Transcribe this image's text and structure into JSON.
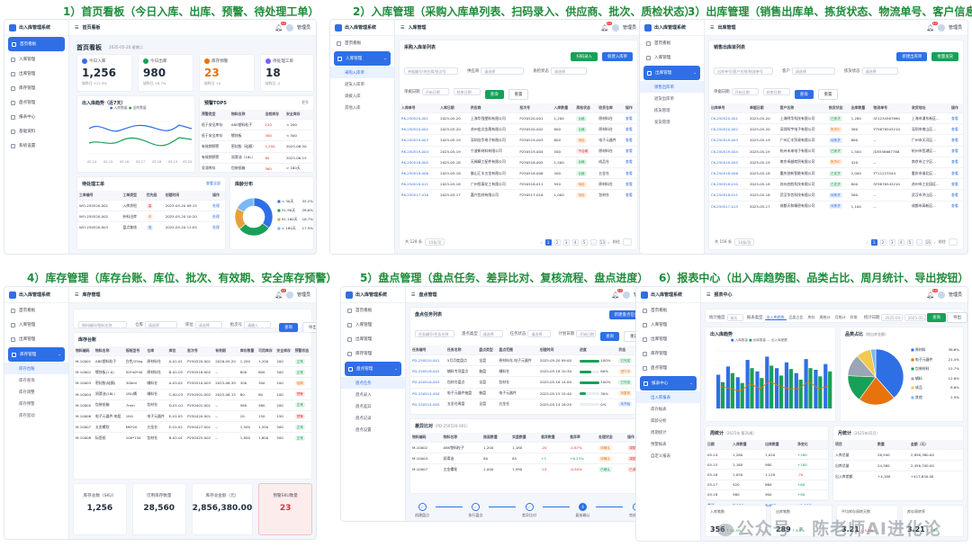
{
  "titles": [
    "1）首页看板（今日入库、出库、预警、待处理工单）",
    "2）入库管理（采购入库单列表、扫码录入、供应商、批次、质检状态）",
    "3）出库管理（销售出库单、拣货状态、物流单号、客户信息）",
    "4）库存管理（库存台账、库位、批次、有效期、安全库存预警）",
    "5）盘点管理（盘点任务、差异比对、复核流程、盘点进度）",
    "6）报表中心（出入库趋势图、品类占比、周月统计、导出按钮）"
  ],
  "app": {
    "name": "出入库管理系统",
    "user": "管理员",
    "badge": "12"
  },
  "nav": [
    "首页看板",
    "入库管理",
    "出库管理",
    "库存管理",
    "盘点管理",
    "报表中心",
    "基础资料",
    "系统设置"
  ],
  "s1": {
    "page": "首页看板",
    "date": "2025-05-20 星期二",
    "kpis": [
      {
        "label": "今日入库",
        "value": "1,256",
        "sub": "较昨日 +12.3%",
        "color": "#2f6fe6"
      },
      {
        "label": "今日出库",
        "value": "980",
        "sub": "较昨日 +8.7%",
        "color": "#18a058"
      },
      {
        "label": "库存预警",
        "value": "23",
        "sub": "较昨日 +4",
        "color": "#e8720c"
      },
      {
        "label": "待处理工单",
        "value": "18",
        "sub": "较昨日 -2",
        "color": "#7b61ff"
      }
    ],
    "trend_title": "出入库趋势（近7天）",
    "legend_in": "入库数量",
    "legend_out": "出库数量",
    "warn_title": "预警TOP5",
    "warn_more": "更多",
    "warn_head": [
      "预警类型",
      "物料名称",
      "当前库存",
      "安全库存"
    ],
    "warn_rows": [
      [
        "低于安全库存",
        "ABS塑料粒子",
        "120",
        "< 200"
      ],
      [
        "低于安全库存",
        "镀锌板",
        "300",
        "< 500"
      ],
      [
        "有效期预警",
        "密封胶（硅酮）",
        "1,200",
        "2025-06-30"
      ],
      [
        "有效期预警",
        "润滑油（18L）",
        "80",
        "2025-06-15"
      ],
      [
        "呆滞库存",
        "包装纸箱",
        "560",
        "> 180天"
      ]
    ],
    "todo_title": "待处理工单",
    "todo_more": "查看全部",
    "todo_head": [
      "工单编号",
      "工单类型",
      "优先级",
      "创建时间",
      "操作"
    ],
    "todo_rows": [
      [
        "WO-250520-001",
        "入库质检",
        "高",
        "2025-05-20 09:15",
        "处理"
      ],
      [
        "WO-250520-002",
        "补料出库",
        "中",
        "2025-05-20 10:20",
        "处理"
      ],
      [
        "WO-250520-003",
        "盘点复核",
        "低",
        "2025-05-20 11:05",
        "处理"
      ]
    ],
    "pie_title": "库龄分布",
    "pie": [
      {
        "label": "< 30天",
        "value": 35.2,
        "color": "#2f6fe6"
      },
      {
        "label": "31-90天",
        "value": 28.6,
        "color": "#18a058"
      },
      {
        "label": "91-180天",
        "value": 18.7,
        "color": "#e8a13a"
      },
      {
        "label": "> 180天",
        "value": 17.5,
        "color": "#7bb8f5"
      }
    ],
    "pie_pct": [
      "35.2%",
      "28.6%",
      "18.7%",
      "17.5%"
    ]
  },
  "s2": {
    "page": "入库管理",
    "list_title": "采购入库单列表",
    "btn_scan": "扫码录入",
    "btn_new": "新建入库单",
    "sub": [
      "采购入库单",
      "退货入库单",
      "调拨入库",
      "其他入库"
    ],
    "f_ph": "单据编号/供应商/批次号",
    "f_sup": "供应商",
    "f_sel": "请选择",
    "f_qc": "质检状态",
    "f_date": "单据日期",
    "f_from": "开始日期",
    "f_to": "结束日期",
    "q": "查询",
    "r": "重置",
    "head": [
      "入库单号",
      "入库日期",
      "供应商",
      "批次号",
      "入库数量",
      "质检状态",
      "收货仓库",
      "操作"
    ],
    "rows": [
      [
        "RK-250520-001",
        "2025-05-20",
        "上海华强塑料有限公司",
        "P250520-001",
        "1,200",
        "合格",
        "原材料仓",
        "查看"
      ],
      [
        "RK-250520-002",
        "2025-05-20",
        "苏州宏达金属有限公司",
        "P250520-002",
        "800",
        "合格",
        "原材料仓",
        "查看"
      ],
      [
        "RK-250519-003",
        "2025-05-19",
        "深圳佳华电子有限公司",
        "P250519-003",
        "600",
        "待检",
        "电子元器件",
        "查看"
      ],
      [
        "RK-250519-004",
        "2025-05-19",
        "宁波新材料有限公司",
        "P250519-004",
        "500",
        "不合格",
        "原材料仓",
        "查看"
      ],
      [
        "RK-250518-005",
        "2025-05-18",
        "无锡精工配件有限公司",
        "P250518-005",
        "1,500",
        "合格",
        "成品仓",
        "查看"
      ],
      [
        "RK-250518-006",
        "2025-05-18",
        "佛山汇丰五金有限公司",
        "P250518-006",
        "300",
        "合格",
        "五金仓",
        "查看"
      ],
      [
        "RK-250518-011",
        "2025-05-18",
        "广州恒泰化工有限公司",
        "P250518-011",
        "950",
        "待检",
        "原材料仓",
        "查看"
      ],
      [
        "RK-250517-016",
        "2025-05-17",
        "嘉兴包材有限公司",
        "P250517-016",
        "1,000",
        "待检",
        "包材仓",
        "查看"
      ]
    ],
    "total": "共 128 条",
    "size": "10条/页",
    "pages": [
      "1",
      "2",
      "3",
      "4",
      "5",
      "…",
      "13"
    ],
    "go": "前往"
  },
  "s3": {
    "page": "出库管理",
    "list_title": "销售出库单列表",
    "btn_new": "新建出库单",
    "btn_batch": "批量发货",
    "sub": [
      "销售出库单",
      "退货出库单",
      "拣货管理",
      "发货管理"
    ],
    "f_ph": "出库单号/客户名称/物流单号",
    "f_cus": "客户",
    "f_pick": "拣货状态",
    "f_date": "单据日期",
    "q": "查询",
    "r": "重置",
    "head": [
      "出库单号",
      "单据日期",
      "客户名称",
      "拣货状态",
      "出库数量",
      "物流单号",
      "收货地址",
      "操作"
    ],
    "rows": [
      [
        "CK-250520-001",
        "2025-05-20",
        "上海明华科技有限公司",
        "已拣货",
        "1,280",
        "SF1234567890",
        "上海市浦东新区...",
        "查看"
      ],
      [
        "CK-250520-002",
        "2025-05-20",
        "深圳科宇电子有限公司",
        "拣货中",
        "360",
        "YT9876543210",
        "深圳市南山区...",
        "查看"
      ],
      [
        "CK-250519-003",
        "2025-05-19",
        "广州汇丰贸易有限公司",
        "待拣货",
        "680",
        "--",
        "广州市天河区...",
        "查看"
      ],
      [
        "CK-250519-004",
        "2025-05-19",
        "杭州未来电子有限公司",
        "已拣货",
        "1,500",
        "JD5556667788",
        "杭州市西湖区...",
        "查看"
      ],
      [
        "CK-250519-005",
        "2025-05-19",
        "南京卓越商贸有限公司",
        "拣货中",
        "420",
        "--",
        "南京市江宁区...",
        "查看"
      ],
      [
        "CK-250518-006",
        "2025-05-18",
        "重庆创新智能有限公司",
        "已发货",
        "2,000",
        "YT11223344",
        "重庆市渝北区...",
        "查看"
      ],
      [
        "CK-250518-010",
        "2025-05-18",
        "苏州启航科技有限公司",
        "已发货",
        "800",
        "SF9876543210",
        "苏州市工业园区...",
        "查看"
      ],
      [
        "CK-250518-011",
        "2025-05-18",
        "武汉华信科技有限公司",
        "待拣货",
        "560",
        "--",
        "武汉市洪山区...",
        "查看"
      ],
      [
        "CK-250517-015",
        "2025-05-17",
        "成都天和精密有限公司",
        "待拣货",
        "1,100",
        "--",
        "成都市高新区...",
        "查看"
      ]
    ],
    "total": "共 156 条",
    "size": "10条/页",
    "pages": [
      "1",
      "2",
      "3",
      "4",
      "5",
      "…",
      "16"
    ],
    "go": "前往"
  },
  "s4": {
    "page": "库存管理",
    "sub": [
      "库存台账",
      "库存查询",
      "库存调整",
      "库存预警",
      "库存变动"
    ],
    "f_ph": "物料编码/物料名称",
    "f_wh": "仓库",
    "f_loc": "库位",
    "f_batch": "批次号",
    "f_sel": "请选择",
    "f_in": "请输入",
    "q": "查询",
    "exp": "导出",
    "list_title": "库存台账",
    "head": [
      "物料编码",
      "物料名称",
      "规格型号",
      "仓库",
      "库位",
      "批次号",
      "有效期",
      "库存数量",
      "可用库存",
      "安全库存",
      "预警状态"
    ],
    "rows": [
      [
        "M-10001",
        "ABS塑料粒子",
        "白色/25kg",
        "原材料仓",
        "A-01-01",
        "P250520-001",
        "2026-05-20",
        "1,200",
        "1,200",
        "200",
        "正常"
      ],
      [
        "M-10002",
        "镀锌板(1.0)",
        "50*40*40",
        "原材料仓",
        "B-02-03",
        "P250518-002",
        "--",
        "800",
        "800",
        "500",
        "正常"
      ],
      [
        "M-10003",
        "密封胶(硅酮)",
        "300ml",
        "辅料仓",
        "A-03-02",
        "P250510-003",
        "2025-06-30",
        "300",
        "300",
        "100",
        "临期"
      ],
      [
        "M-10004",
        "润滑油(18L)",
        "18L/桶",
        "辅料仓",
        "C-00-03",
        "P250501-002",
        "2025-06-15",
        "80",
        "80",
        "100",
        "预警"
      ],
      [
        "M-10005",
        "包装纸箱",
        "7mm",
        "包材仓",
        "D-01-01",
        "P250401-001",
        "--",
        "560",
        "560",
        "200",
        "正常"
      ],
      [
        "M-10006",
        "电子元器件-电阻",
        "1KΩ",
        "电子元器件",
        "E-01-05",
        "P250420-001",
        "--",
        "20",
        "150",
        "150",
        "预警"
      ],
      [
        "M-10007",
        "五金螺栓",
        "M6*20",
        "五金仓",
        "E-01-02",
        "P250427-001",
        "--",
        "1,500",
        "1,500",
        "500",
        "正常"
      ],
      [
        "M-10008",
        "标签纸",
        "100*150",
        "包材仓",
        "B-02-01",
        "P250425-002",
        "--",
        "1,800",
        "1,800",
        "500",
        "正常"
      ]
    ],
    "stats": [
      {
        "label": "库存总数（SKU）",
        "value": "1,256"
      },
      {
        "label": "可用库存数量",
        "value": "28,560"
      },
      {
        "label": "库存总金额（元）",
        "value": "2,856,380.00"
      },
      {
        "label": "预警SKU数量",
        "value": "23"
      }
    ]
  },
  "s5": {
    "page": "盘点管理",
    "list_title": "盘点任务列表",
    "btn_new": "新建盘点任务",
    "sub": [
      "盘点任务",
      "盘点录入",
      "盘点差异",
      "盘点记录",
      "盘点设置"
    ],
    "f_ph": "任务编号/任务名称",
    "f_type": "盘点类型",
    "f_status": "任务状态",
    "f_date": "计划日期",
    "f_sel": "请选择",
    "q": "查询",
    "r": "重置",
    "head": [
      "任务编号",
      "任务名称",
      "盘点类型",
      "盘点范围",
      "创建时间",
      "进度",
      "状态",
      "操作"
    ],
    "rows": [
      [
        "PD-250520-001",
        "5月月度盘点",
        "全盘",
        "原材料仓,电子元器件",
        "2025-05-20 09:00",
        1.0,
        "100%",
        "已完成",
        "查看"
      ],
      [
        "PD-250518-002",
        "辅料专项盘点",
        "抽盘",
        "辅料仓",
        "2025-05-18 10:30",
        0.6,
        "60%",
        "进行中",
        "查看"
      ],
      [
        "PD-250516-003",
        "包材仓盘点",
        "全盘",
        "包材仓",
        "2025-05-16 14:00",
        1.0,
        "100%",
        "已完成",
        "查看"
      ],
      [
        "PD-250515-004",
        "电子元器件抽盘",
        "抽盘",
        "电子元器件",
        "2025-05-15 15:40",
        0.3,
        "30%",
        "待复核",
        "查看"
      ],
      [
        "PD-250514-005",
        "五金仓周盘",
        "全盘",
        "五金仓",
        "2025-05-14 16:20",
        0.0,
        "0%",
        "未开始",
        "查看"
      ]
    ],
    "diff_title": "差异比对",
    "diff_task": "（PD-250520-001）",
    "diff_head": [
      "物料编码",
      "物料名称",
      "账面数量",
      "实盘数量",
      "差异数量",
      "差异率",
      "处理状态",
      "操作"
    ],
    "diff_rows": [
      [
        "M-10002",
        "ABS塑料粒子",
        "1,200",
        "1,180",
        "-20",
        "-1.67%",
        "待确认",
        "调整"
      ],
      [
        "M-10004",
        "润滑油",
        "80",
        "85",
        "+5",
        "+6.25%",
        "待确认",
        "调整"
      ],
      [
        "M-10007",
        "五金螺栓",
        "2,000",
        "1,990",
        "-10",
        "-0.50%",
        "已确认",
        "已调"
      ]
    ],
    "steps": [
      "创建盘点",
      "执行盘点",
      "差异比对",
      "复核确认",
      "完成盘点"
    ]
  },
  "s6": {
    "page": "报表中心",
    "f_dim": "统计维度",
    "f_dim_v": "按天",
    "f_type": "报表类型",
    "tabs": [
      "出入库趋势",
      "品类占比",
      "库存",
      "周统计",
      "月统计",
      "异常"
    ],
    "f_date": "统计日期",
    "d_from": "2025-04-20",
    "d_to": "2025-05-20",
    "q": "查询",
    "exp": "导出",
    "sub": [
      "出入库报表",
      "库存报表",
      "库龄分析",
      "周期统计",
      "预警报表",
      "自定义报表"
    ],
    "trend_title": "出入库趋势",
    "leg": [
      "入库数量",
      "出库数量",
      "出入库差额"
    ],
    "bars_in": [
      820,
      1020,
      760,
      1180,
      900,
      1260,
      980,
      1120,
      860,
      1200,
      940,
      1080
    ],
    "bars_out": [
      640,
      860,
      620,
      980,
      740,
      1040,
      800,
      960,
      700,
      980,
      780,
      900
    ],
    "line": [
      180,
      160,
      140,
      200,
      160,
      220,
      180,
      160,
      160,
      220,
      160,
      180
    ],
    "cat_title": "品类占比",
    "cat_sub": "（按出库金额）",
    "cats": [
      {
        "label": "原材料",
        "value": 38.6,
        "color": "#2f6fe6"
      },
      {
        "label": "电子元器件",
        "value": 21.4,
        "color": "#e8720c"
      },
      {
        "label": "包装材料",
        "value": 15.7,
        "color": "#18a058"
      },
      {
        "label": "辅料",
        "value": 12.8,
        "color": "#9aa5b5"
      },
      {
        "label": "成品",
        "value": 8.6,
        "color": "#f2c94c"
      },
      {
        "label": "其他",
        "value": 2.9,
        "color": "#7bb8f5"
      }
    ],
    "cat_pct": [
      "38.6%",
      "21.4%",
      "15.7%",
      "12.8%",
      "8.6%",
      "2.9%"
    ],
    "week_title": "周统计",
    "week_sub": "（2025年 第20周）",
    "week_head": [
      "日期",
      "入库数量",
      "出库数量",
      "净变化"
    ],
    "week_rows": [
      [
        "05-14",
        "1,280",
        "1,020",
        "+260"
      ],
      [
        "05-15",
        "1,160",
        "980",
        "+180"
      ],
      [
        "05-16",
        "1,050",
        "1,120",
        "-70"
      ],
      [
        "05-17",
        "920",
        "860",
        "+60"
      ],
      [
        "05-18",
        "980",
        "900",
        "+80"
      ],
      [
        "合计",
        "7,000",
        "6,000",
        "+1,000"
      ]
    ],
    "month_title": "月统计",
    "month_sub": "（2025年05月）",
    "month_head": [
      "项目",
      "数量",
      "金额（元）"
    ],
    "month_rows": [
      [
        "入库总量",
        "26,500",
        "2,856,380.00"
      ],
      [
        "出库总量",
        "24,380",
        "2,456,700.00"
      ],
      [
        "出入库差额",
        "+4,180",
        "+417,630.00"
      ]
    ],
    "mini": [
      {
        "label": "入库笔数",
        "value": "356",
        "sub": "↑ 12.4%"
      },
      {
        "label": "出库笔数",
        "value": "289",
        "sub": "↑ 8.6%"
      },
      {
        "label": "平均库存周转天数",
        "value": "3.21",
        "sub": "↓ 3.2%"
      },
      {
        "label": "库存周转率",
        "value": "3.21",
        "sub": "↑ 1.6%"
      }
    ]
  },
  "watermark": "公众号 · 陈老师AI进化论"
}
